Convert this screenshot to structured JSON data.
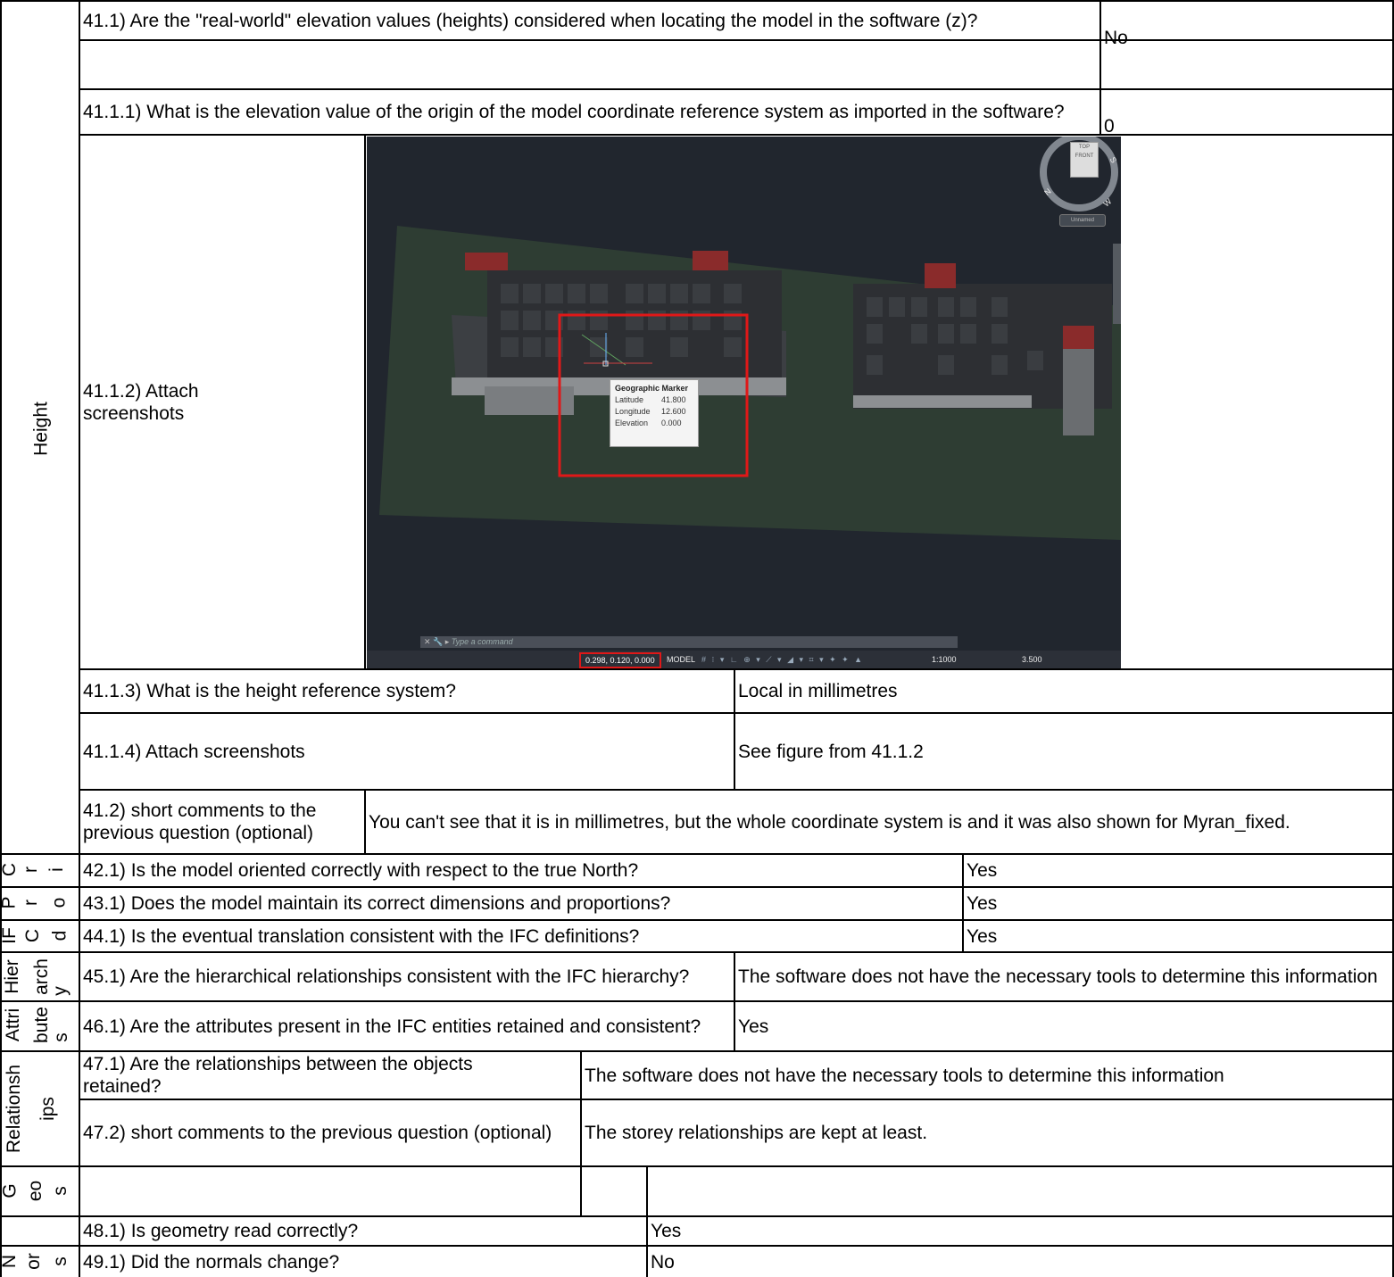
{
  "sections": {
    "height": "Height",
    "hierarchy_line1": "Hier",
    "hierarchy_line2": "arch",
    "attributes_line1": "Attri",
    "attributes_line2": "bute",
    "relationships_line1": "Relationsh",
    "relationships_line2": "ips"
  },
  "side_fragments": {
    "f42": [
      "C",
      "r",
      "i"
    ],
    "f43": [
      "P",
      "r",
      "o"
    ],
    "f44": [
      "IF",
      "C",
      "d"
    ],
    "f45": "y",
    "f46": "s",
    "f48": [
      "G",
      "eo",
      "s"
    ],
    "f49": [
      "N",
      "or",
      "s"
    ]
  },
  "rows": {
    "q41_1": {
      "question": "41.1) Are the \"real-world\" elevation values (heights)  considered when locating the model in the software (z)?",
      "answer": "No"
    },
    "q41_1_1": {
      "question": "41.1.1) What is the elevation value of the origin of the model coordinate reference system as imported in the software?",
      "answer": "0"
    },
    "q41_1_2": {
      "question": "41.1.2) Attach screenshots"
    },
    "q41_1_3": {
      "question": "41.1.3) What is the height reference system?",
      "answer": "Local in millimetres"
    },
    "q41_1_4": {
      "question": "41.1.4) Attach screenshots",
      "answer": "See figure from 41.1.2"
    },
    "q41_2": {
      "question": "41.2) short comments to the previous question (optional)",
      "answer": "You can't see that it is in millimetres, but the whole coordinate system is and it was also shown for Myran_fixed."
    },
    "q42_1": {
      "question": "42.1) Is the model oriented correctly with respect to the true North?",
      "answer": "Yes"
    },
    "q43_1": {
      "question": "43.1) Does the model maintain its correct dimensions and proportions?",
      "answer": "Yes"
    },
    "q44_1": {
      "question": "44.1) Is the eventual translation consistent with the IFC definitions?",
      "answer": "Yes"
    },
    "q45_1": {
      "question": "45.1) Are the hierarchical relationships consistent with the IFC hierarchy?",
      "answer": "The software does not have the necessary tools to determine this information"
    },
    "q46_1": {
      "question": "46.1) Are the attributes present in the IFC entities retained and consistent?",
      "answer": "Yes"
    },
    "q47_1": {
      "question": "47.1) Are the relationships between the objects retained?",
      "answer": "The software does not have the necessary tools to determine this information"
    },
    "q47_2": {
      "question": "47.2) short comments to the previous question (optional)",
      "answer": "The storey relationships are kept at least."
    },
    "q48_1": {
      "question": "48.1) Is geometry read correctly?",
      "answer": "Yes"
    },
    "q49_1": {
      "question": "49.1) Did the normals change?",
      "answer": "No"
    }
  },
  "screenshot": {
    "popup_title": "Geographic Marker",
    "popup_rows": [
      {
        "label": "Latitude",
        "value": "41.800"
      },
      {
        "label": "Longitude",
        "value": "12.600"
      },
      {
        "label": "Elevation",
        "value": "0.000"
      }
    ],
    "command_placeholder": "Type a command",
    "coordinates": "0.298, 0.120, 0.000",
    "model_label": "MODEL",
    "scale": "1:1000",
    "value": "3.500",
    "cube_top": "TOP",
    "cube_front": "FRONT",
    "compass": [
      "N",
      "S",
      "W"
    ],
    "view_name": "Unnamed",
    "highlight_color": "#e01818"
  }
}
